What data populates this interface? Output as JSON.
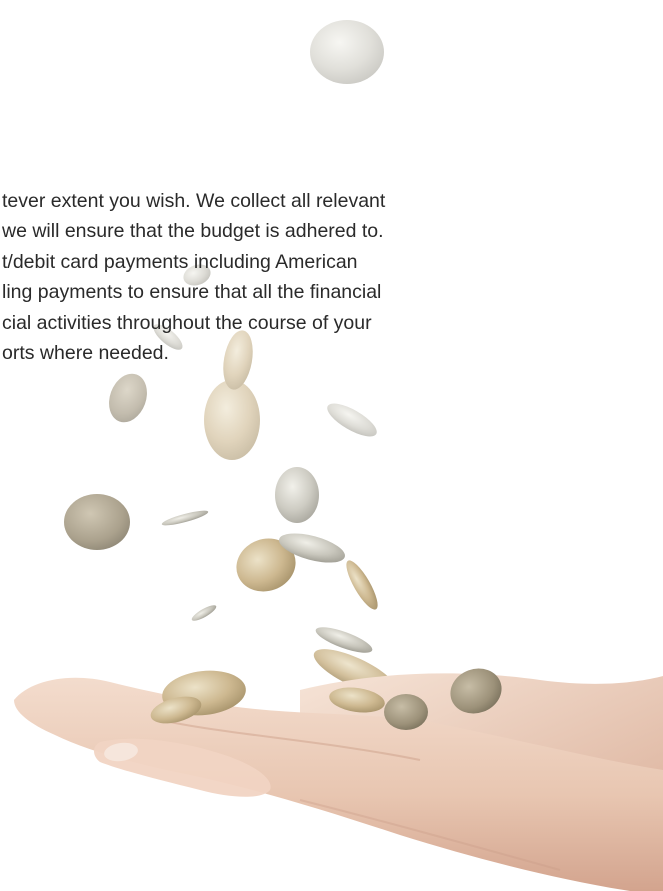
{
  "content": {
    "lines": [
      "tever extent you wish.  We collect all relevant",
      "we will ensure that the budget is adhered to.",
      "t/debit card payments including American",
      "ling payments to ensure that all the financial",
      "cial activities throughout the course of your",
      "orts where needed."
    ]
  },
  "illustration": {
    "icon": "coins-falling-into-cupped-hands-icon",
    "colors": {
      "coin_gold": "#c9b48a",
      "coin_silver": "#b9b7ad",
      "skin": "#e8c8b4",
      "skin_shadow": "#c99c86"
    }
  }
}
